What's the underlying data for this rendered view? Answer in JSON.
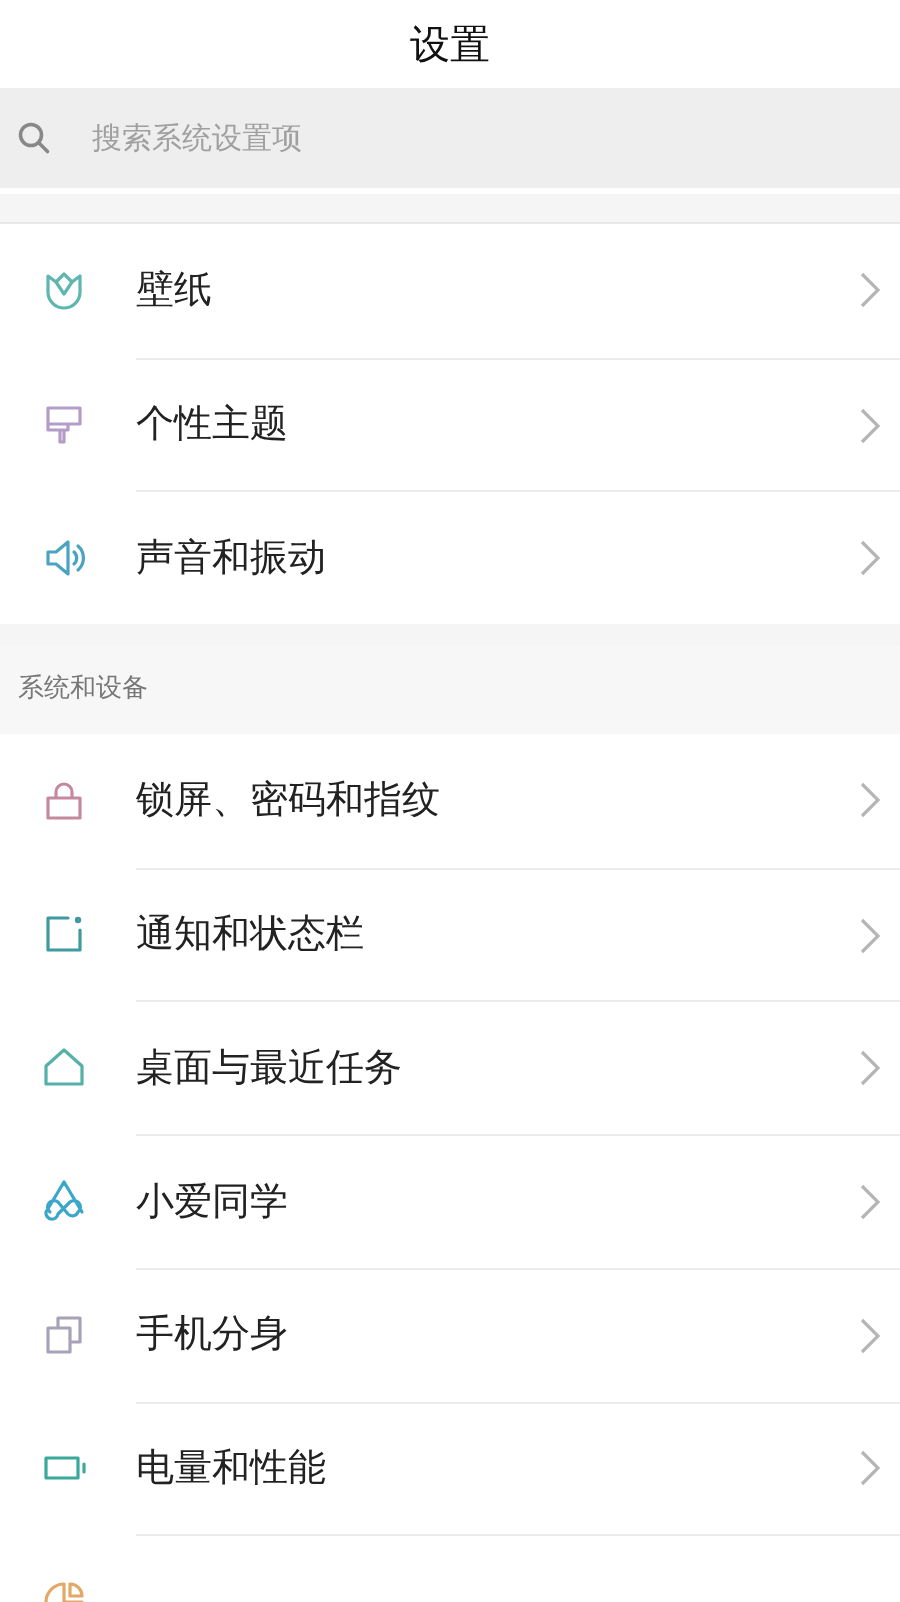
{
  "title": "设置",
  "search": {
    "placeholder": "搜索系统设置项"
  },
  "groups": [
    {
      "items": [
        {
          "label": "壁纸",
          "kind": "tulip",
          "color": "#5fb5b0"
        },
        {
          "label": "个性主题",
          "kind": "brush",
          "color": "#b49cc8"
        },
        {
          "label": "声音和振动",
          "kind": "speaker",
          "color": "#4aa3c0"
        }
      ]
    },
    {
      "header": "系统和设备",
      "items": [
        {
          "label": "锁屏、密码和指纹",
          "kind": "lock",
          "color": "#c48a9c"
        },
        {
          "label": "通知和状态栏",
          "kind": "notification",
          "color": "#3f9a9e"
        },
        {
          "label": "桌面与最近任务",
          "kind": "home",
          "color": "#55b0a8"
        },
        {
          "label": "小爱同学",
          "kind": "assistant",
          "color": "#3aa6c8"
        },
        {
          "label": "手机分身",
          "kind": "clone",
          "color": "#a8a2b8"
        },
        {
          "label": "电量和性能",
          "kind": "battery",
          "color": "#3aa89a"
        },
        {
          "kind": "storage",
          "color": "#e3a866"
        }
      ]
    }
  ]
}
